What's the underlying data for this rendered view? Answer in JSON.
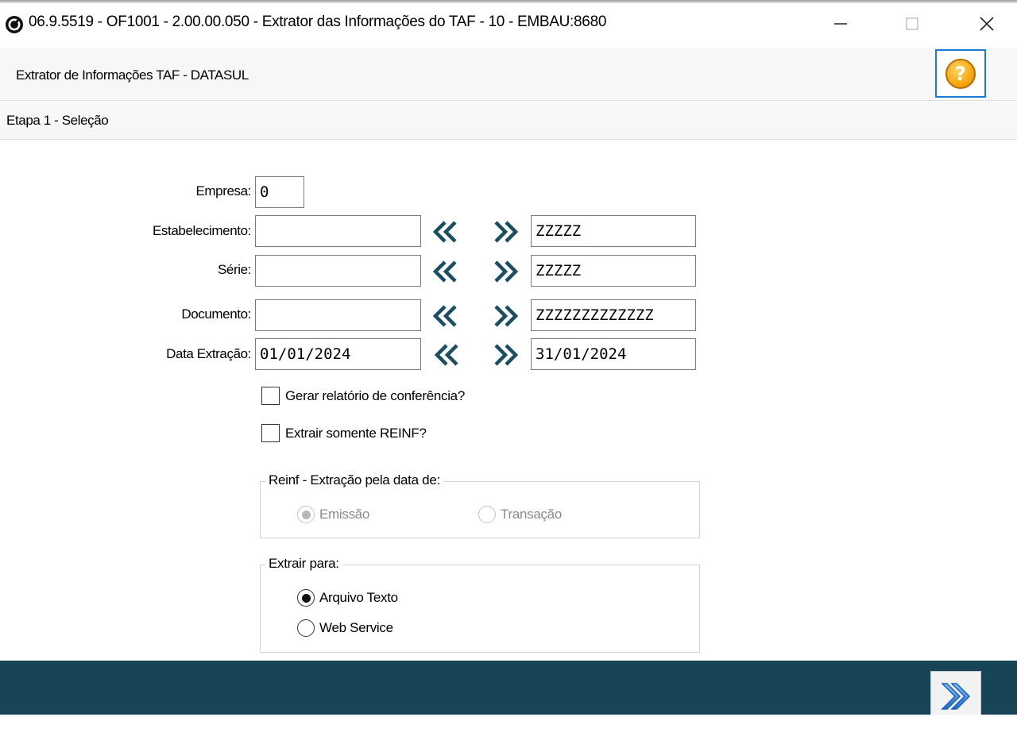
{
  "window": {
    "title": "06.9.5519 - OF1001 - 2.00.00.050 - Extrator das Informações do TAF - 10 - EMBAU:8680",
    "icons": {
      "app": "totvs-logo-icon",
      "minimize": "minimize-icon",
      "maximize": "maximize-icon",
      "close": "close-icon"
    }
  },
  "header": {
    "title": "Extrator de Informações TAF - DATASUL",
    "help_icon": "help-question-icon",
    "help_color": "#f5a000"
  },
  "step": {
    "title": "Etapa 1 - Seleção"
  },
  "form": {
    "empresa": {
      "label": "Empresa:",
      "value": "0"
    },
    "estabelecimento": {
      "label": "Estabelecimento:",
      "from": "",
      "to": "ZZZZZ"
    },
    "serie": {
      "label": "Série:",
      "from": "",
      "to": "ZZZZZ"
    },
    "documento": {
      "label": "Documento:",
      "from": "",
      "to": "ZZZZZZZZZZZZZ"
    },
    "data_extracao": {
      "label": "Data Extração:",
      "from": "01/01/2024",
      "to": "31/01/2024"
    },
    "arrow_color": "#1a4f63",
    "gerar_relatorio": {
      "label": "Gerar relatório de conferência?",
      "checked": false
    },
    "extrair_reinf": {
      "label": "Extrair somente REINF?",
      "checked": false
    },
    "reinf_group": {
      "title": "Reinf - Extração pela data de:",
      "options": [
        {
          "label": "Emissão",
          "selected": true,
          "enabled": false
        },
        {
          "label": "Transação",
          "selected": false,
          "enabled": false
        }
      ]
    },
    "extrair_group": {
      "title": "Extrair para:",
      "options": [
        {
          "label": "Arquivo Texto",
          "selected": true,
          "enabled": true
        },
        {
          "label": "Web Service",
          "selected": false,
          "enabled": true
        }
      ]
    }
  },
  "footer": {
    "color": "#174557",
    "next_icon": "next-double-arrow-icon"
  }
}
